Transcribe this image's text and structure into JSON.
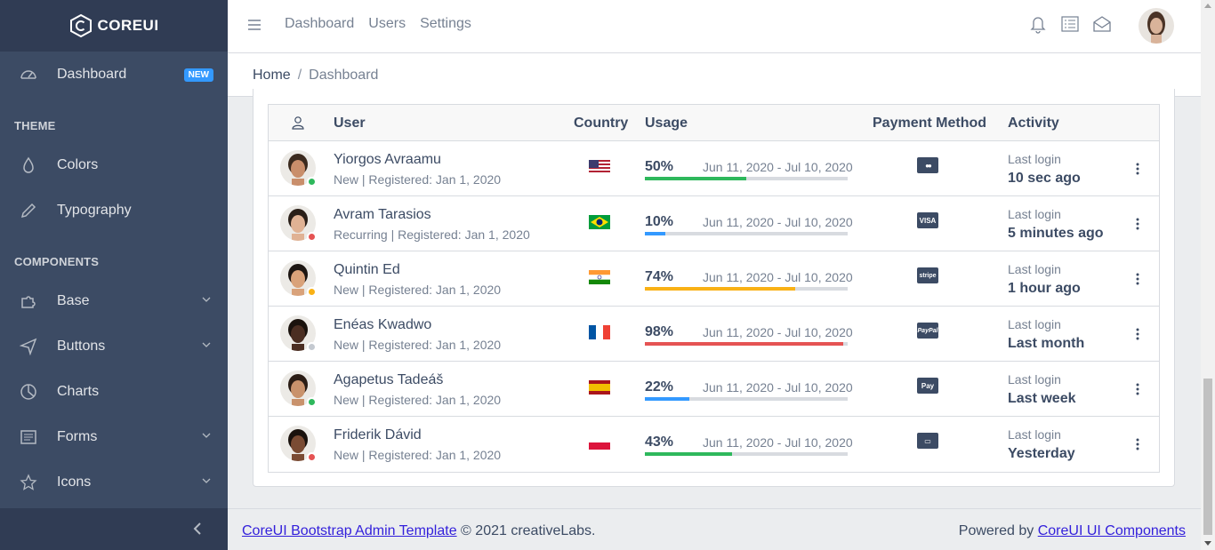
{
  "brand": {
    "name": "COREUI"
  },
  "sidebar": {
    "items": [
      {
        "label": "Dashboard",
        "icon": "speedometer-icon",
        "badge": "NEW"
      },
      {
        "section": "THEME"
      },
      {
        "label": "Colors",
        "icon": "drop-icon"
      },
      {
        "label": "Typography",
        "icon": "pencil-icon"
      },
      {
        "section": "COMPONENTS"
      },
      {
        "label": "Base",
        "icon": "puzzle-icon",
        "expandable": true
      },
      {
        "label": "Buttons",
        "icon": "cursor-icon",
        "expandable": true
      },
      {
        "label": "Charts",
        "icon": "chart-pie-icon"
      },
      {
        "label": "Forms",
        "icon": "notes-icon",
        "expandable": true
      },
      {
        "label": "Icons",
        "icon": "star-icon",
        "expandable": true
      }
    ]
  },
  "header": {
    "nav": [
      "Dashboard",
      "Users",
      "Settings"
    ],
    "icons": [
      "bell-icon",
      "list-icon",
      "envelope-open-icon"
    ]
  },
  "breadcrumb": {
    "home": "Home",
    "separator": "/",
    "current": "Dashboard"
  },
  "table": {
    "columns": {
      "icon": "people-icon",
      "user": "User",
      "country": "Country",
      "usage": "Usage",
      "payment": "Payment Method",
      "activity": "Activity"
    },
    "rows": [
      {
        "name": "Yiorgos Avraamu",
        "meta": "New | Registered: Jan 1, 2020",
        "status": "#2eb85c",
        "country": "us",
        "usage": "50%",
        "usage_value": 50,
        "bar_color": "#2eb85c",
        "range": "Jun 11, 2020 - Jul 10, 2020",
        "payment": "mastercard",
        "payment_icon": "mastercard-icon",
        "activity_label": "Last login",
        "activity": "10 sec ago"
      },
      {
        "name": "Avram Tarasios",
        "meta": "Recurring | Registered: Jan 1, 2020",
        "status": "#e55353",
        "country": "br",
        "usage": "10%",
        "usage_value": 10,
        "bar_color": "#39f",
        "range": "Jun 11, 2020 - Jul 10, 2020",
        "payment": "VISA",
        "payment_icon": "visa-icon",
        "activity_label": "Last login",
        "activity": "5 minutes ago"
      },
      {
        "name": "Quintin Ed",
        "meta": "New | Registered: Jan 1, 2020",
        "status": "#f9b115",
        "country": "in",
        "usage": "74%",
        "usage_value": 74,
        "bar_color": "#f9b115",
        "range": "Jun 11, 2020 - Jul 10, 2020",
        "payment": "stripe",
        "payment_icon": "stripe-icon",
        "activity_label": "Last login",
        "activity": "1 hour ago"
      },
      {
        "name": "Enéas Kwadwo",
        "meta": "New | Registered: Jan 1, 2020",
        "status": "#c4c9d0",
        "country": "fr",
        "usage": "98%",
        "usage_value": 98,
        "bar_color": "#e55353",
        "range": "Jun 11, 2020 - Jul 10, 2020",
        "payment": "PayPal",
        "payment_icon": "paypal-icon",
        "activity_label": "Last login",
        "activity": "Last month"
      },
      {
        "name": "Agapetus Tadeáš",
        "meta": "New | Registered: Jan 1, 2020",
        "status": "#2eb85c",
        "country": "es",
        "usage": "22%",
        "usage_value": 22,
        "bar_color": "#39f",
        "range": "Jun 11, 2020 - Jul 10, 2020",
        "payment": "Pay",
        "payment_icon": "apple-pay-icon",
        "activity_label": "Last login",
        "activity": "Last week"
      },
      {
        "name": "Friderik Dávid",
        "meta": "New | Registered: Jan 1, 2020",
        "status": "#e55353",
        "country": "pl",
        "usage": "43%",
        "usage_value": 43,
        "bar_color": "#2eb85c",
        "range": "Jun 11, 2020 - Jul 10, 2020",
        "payment": "amex",
        "payment_icon": "amex-icon",
        "activity_label": "Last login",
        "activity": "Yesterday"
      }
    ]
  },
  "footer": {
    "left_link": "CoreUI Bootstrap Admin Template",
    "left_text": " © 2021 creativeLabs.",
    "right_text": "Powered by ",
    "right_link": "CoreUI UI Components"
  }
}
